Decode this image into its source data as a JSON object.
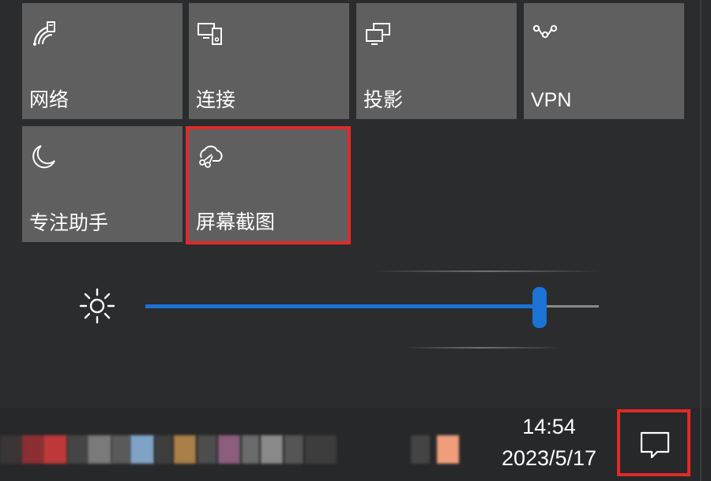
{
  "quick_actions": [
    {
      "label": "网络",
      "icon": "network-icon"
    },
    {
      "label": "连接",
      "icon": "connect-icon"
    },
    {
      "label": "投影",
      "icon": "project-icon"
    },
    {
      "label": "VPN",
      "icon": "vpn-icon"
    },
    {
      "label": "专注助手",
      "icon": "focus-assist-moon-icon"
    },
    {
      "label": "屏幕截图",
      "icon": "screen-snip-icon",
      "highlighted": true
    }
  ],
  "brightness": {
    "icon": "brightness-sun-icon",
    "level": 0.87
  },
  "taskbar": {
    "time": "14:54",
    "date": "2023/5/17",
    "action_center_icon": "notification-icon",
    "highlight_color": "#e02a2a"
  },
  "colors": {
    "tile": "#5f5f5f",
    "background": "#2b2c2e",
    "accent": "#1b73d6"
  }
}
